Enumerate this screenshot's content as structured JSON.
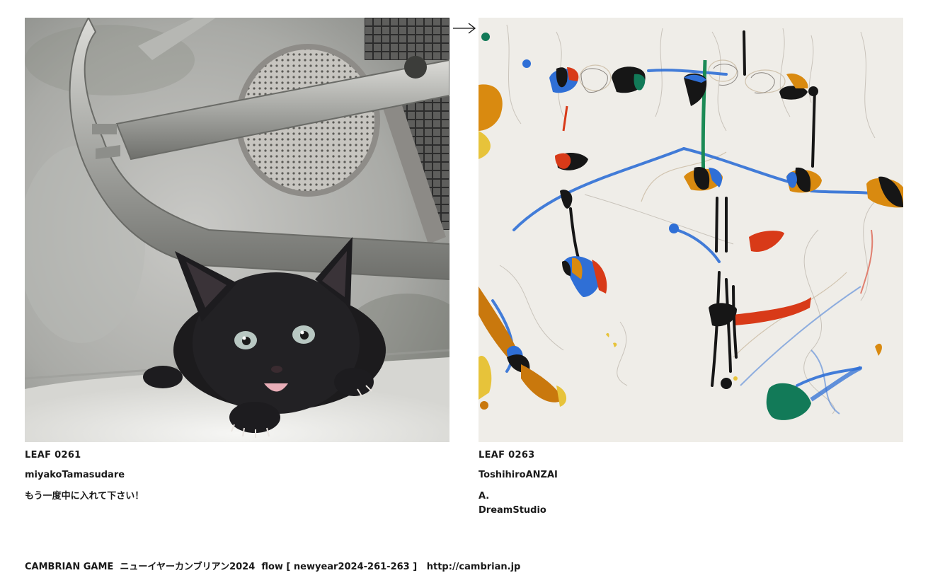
{
  "leaves": [
    {
      "id": "LEAF 0261",
      "author": "miyakoTamasudare",
      "caption": [
        "もう一度中に入れて下さい！"
      ],
      "image_icon": "black-kitten-photo"
    },
    {
      "id": "LEAF 0263",
      "author": "ToshihiroANZAI",
      "caption": [
        "A.",
        "DreamStudio"
      ],
      "image_icon": "abstract-painting"
    }
  ],
  "flow_arrow_icon": "right-arrow-icon",
  "footer": {
    "game": "CAMBRIAN GAME",
    "title": "ニューイヤーカンブリアン2024",
    "flow": "flow [ newyear2024-261-263 ]",
    "url": "http://cambrian.jp"
  },
  "colors": {
    "text": "#1a1a1a",
    "background": "#ffffff",
    "accent_red": "#d83a18",
    "accent_blue": "#2f6fd6",
    "accent_orange": "#d98a10",
    "accent_green": "#127a58"
  }
}
